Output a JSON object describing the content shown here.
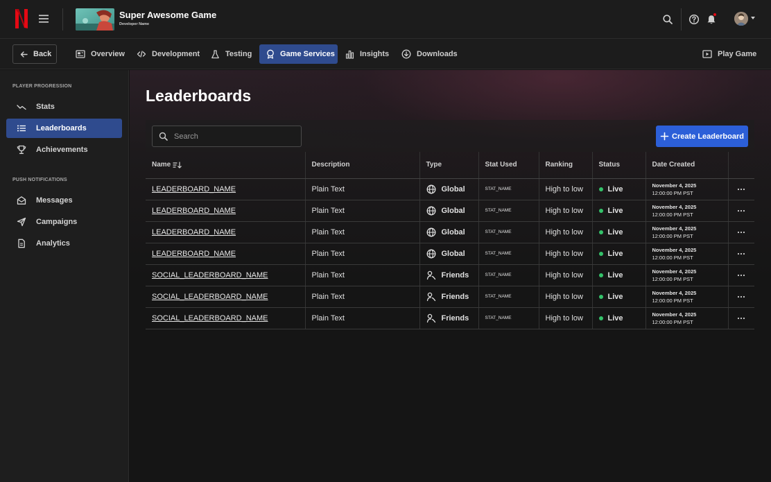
{
  "header": {
    "game_title": "Super Awesome Game",
    "developer_name": "Developer Name"
  },
  "tabs": {
    "back_label": "Back",
    "items": [
      "Overview",
      "Development",
      "Testing",
      "Game Services",
      "Insights",
      "Downloads"
    ],
    "active": "Game Services",
    "play_label": "Play Game"
  },
  "sidebar": {
    "sections": [
      {
        "label": "PLAYER PROGRESSION",
        "items": [
          "Stats",
          "Leaderboards",
          "Achievements"
        ]
      },
      {
        "label": "PUSH NOTIFICATIONS",
        "items": [
          "Messages",
          "Campaigns",
          "Analytics"
        ]
      }
    ],
    "active": "Leaderboards"
  },
  "main": {
    "title": "Leaderboards",
    "search_placeholder": "Search",
    "create_label": "Create Leaderboard",
    "columns": [
      "Name",
      "Description",
      "Type",
      "Stat Used",
      "Ranking",
      "Status",
      "Date Created"
    ],
    "rows": [
      {
        "name": "LEADERBOARD_NAME",
        "description": "Plain Text",
        "type": "Global",
        "stat": "STAT_NAME",
        "ranking": "High to low",
        "status": "Live",
        "date": "November 4, 2025",
        "time": "12:00:00 PM PST"
      },
      {
        "name": "LEADERBOARD_NAME",
        "description": "Plain Text",
        "type": "Global",
        "stat": "STAT_NAME",
        "ranking": "High to low",
        "status": "Live",
        "date": "November 4, 2025",
        "time": "12:00:00 PM PST"
      },
      {
        "name": "LEADERBOARD_NAME",
        "description": "Plain Text",
        "type": "Global",
        "stat": "STAT_NAME",
        "ranking": "High to low",
        "status": "Live",
        "date": "November 4, 2025",
        "time": "12:00:00 PM PST"
      },
      {
        "name": "LEADERBOARD_NAME",
        "description": "Plain Text",
        "type": "Global",
        "stat": "STAT_NAME",
        "ranking": "High to low",
        "status": "Live",
        "date": "November 4, 2025",
        "time": "12:00:00 PM PST"
      },
      {
        "name": "SOCIAL_LEADERBOARD_NAME",
        "description": "Plain Text",
        "type": "Friends",
        "stat": "STAT_NAME",
        "ranking": "High to low",
        "status": "Live",
        "date": "November 4, 2025",
        "time": "12:00:00 PM PST"
      },
      {
        "name": "SOCIAL_LEADERBOARD_NAME",
        "description": "Plain Text",
        "type": "Friends",
        "stat": "STAT_NAME",
        "ranking": "High to low",
        "status": "Live",
        "date": "November 4, 2025",
        "time": "12:00:00 PM PST"
      },
      {
        "name": "SOCIAL_LEADERBOARD_NAME",
        "description": "Plain Text",
        "type": "Friends",
        "stat": "STAT_NAME",
        "ranking": "High to low",
        "status": "Live",
        "date": "November 4, 2025",
        "time": "12:00:00 PM PST"
      }
    ]
  },
  "colors": {
    "accent": "#2f4b8e",
    "primary_button": "#2c5fd8",
    "live": "#34c26a",
    "brand": "#e50914"
  },
  "icons": {
    "header": [
      "netflix-logo",
      "menu-icon",
      "search-icon",
      "help-icon",
      "bell-icon",
      "avatar"
    ],
    "tabs": [
      "arrow-left-icon",
      "overview-icon",
      "code-icon",
      "flask-icon",
      "medal-icon",
      "bar-chart-icon",
      "download-icon",
      "play-icon"
    ],
    "sidebar": [
      "trend-icon",
      "list-icon",
      "trophy-icon",
      "envelope-icon",
      "send-icon",
      "document-icon"
    ],
    "table": [
      "sort-icon",
      "globe-icon",
      "friends-icon",
      "more-icon",
      "plus-icon"
    ]
  }
}
